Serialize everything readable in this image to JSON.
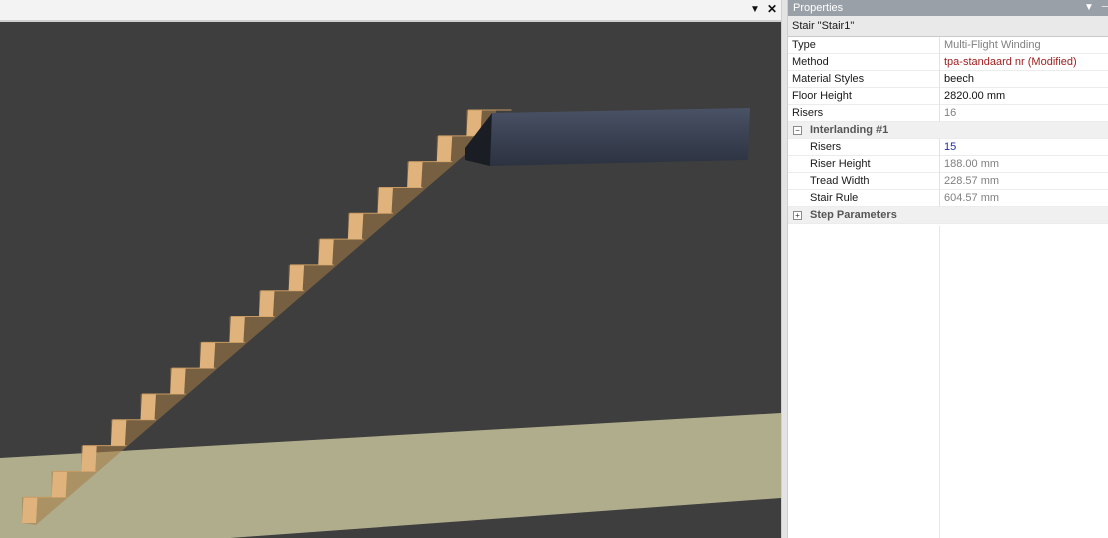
{
  "viewport": {
    "menu_icon": "▼",
    "close_icon": "✕",
    "stair_step_count": 16,
    "colors": {
      "background": "#3e3e3e",
      "floor": "#b0ad8d",
      "wood_tread": "#c79a61",
      "wood_riser": "#e0b27c",
      "wood_side": "#a57b45",
      "landing": "#3a4152"
    }
  },
  "properties": {
    "title": "Properties",
    "object": "Stair \"Stair1\"",
    "rows": [
      {
        "key": "Type",
        "value": "Multi-Flight Winding",
        "style": "grey"
      },
      {
        "key": "Method",
        "value": "tpa-standaard nr (Modified)",
        "style": "red"
      },
      {
        "key": "Material Styles",
        "value": "beech",
        "style": "black"
      },
      {
        "key": "Floor Height",
        "value": "2820.00 mm",
        "style": "black"
      },
      {
        "key": "Risers",
        "value": "16",
        "style": "grey"
      }
    ],
    "interlanding": {
      "label": "Interlanding #1",
      "expander": "−",
      "rows": [
        {
          "key": "Risers",
          "value": "15",
          "style": "blue"
        },
        {
          "key": "Riser Height",
          "value": "188.00 mm",
          "style": "grey"
        },
        {
          "key": "Tread Width",
          "value": "228.57 mm",
          "style": "grey"
        },
        {
          "key": "Stair Rule",
          "value": "604.57 mm",
          "style": "grey"
        }
      ]
    },
    "step_parameters": {
      "label": "Step Parameters",
      "expander": "+"
    }
  }
}
